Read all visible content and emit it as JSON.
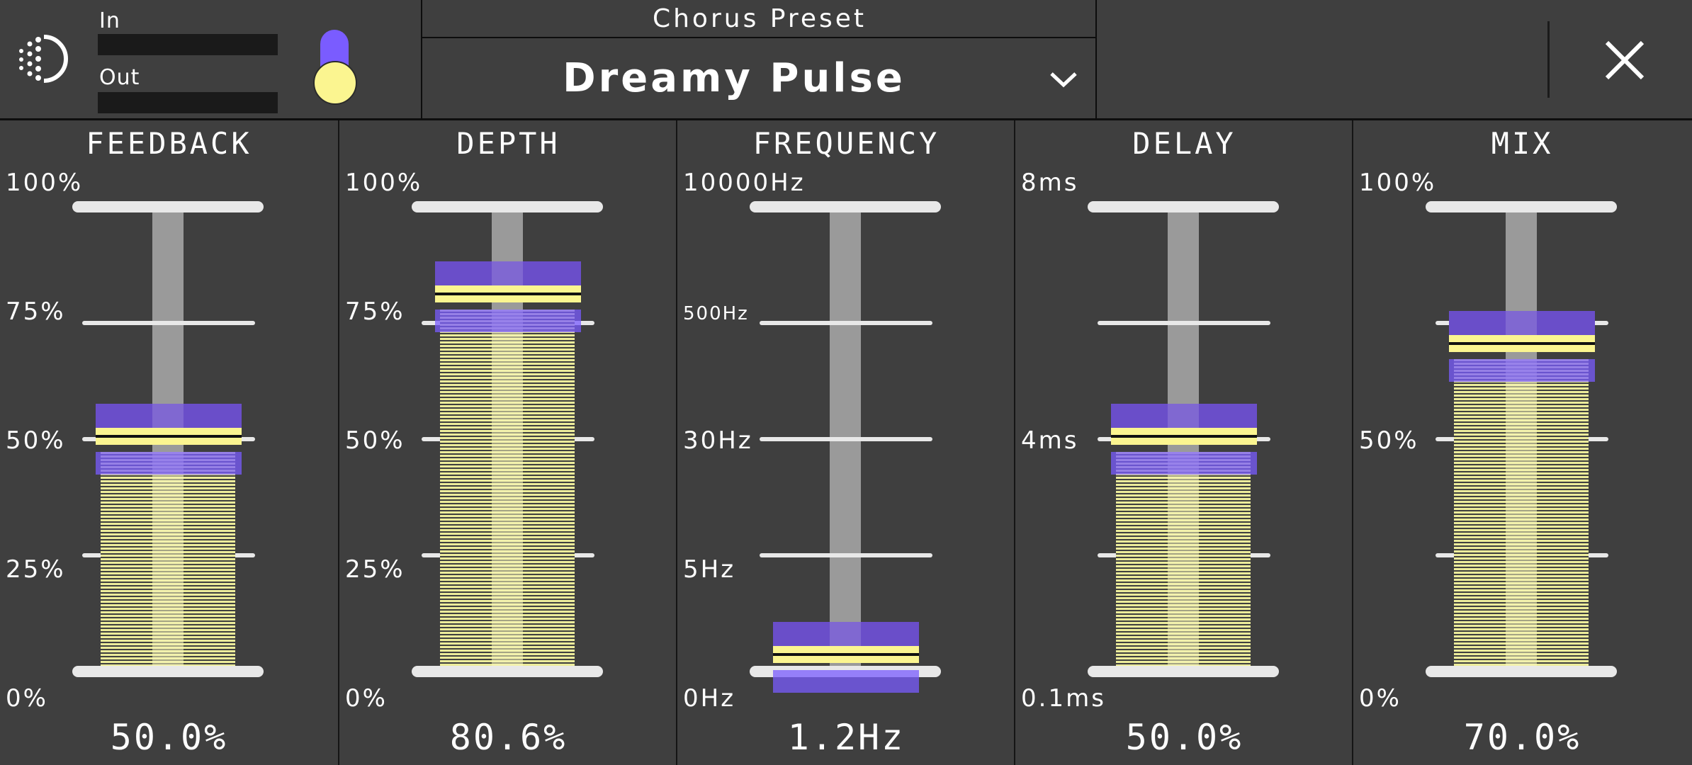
{
  "header": {
    "meters": {
      "in_label": "In",
      "out_label": "Out"
    },
    "preset": {
      "label": "Chorus Preset",
      "name": "Dreamy Pulse"
    },
    "icons": {
      "logo": "plugin-logo-icon",
      "dropdown": "chevron-down-icon",
      "close": "close-icon"
    },
    "toggle": {
      "state": "on"
    }
  },
  "colors": {
    "background": "#3f3f3f",
    "accent_purple": "#7a5cff",
    "accent_yellow": "#fbf590",
    "rail": "#e8e8e8",
    "track": "#9a9a9a"
  },
  "faders": [
    {
      "id": "feedback",
      "title": "FEEDBACK",
      "value": "50.0%",
      "level": 0.5,
      "ticks": [
        "100%",
        "75%",
        "50%",
        "25%",
        "0%"
      ]
    },
    {
      "id": "depth",
      "title": "DEPTH",
      "value": "80.6%",
      "level": 0.806,
      "ticks": [
        "100%",
        "75%",
        "50%",
        "25%",
        "0%"
      ]
    },
    {
      "id": "frequency",
      "title": "FREQUENCY",
      "value": "1.2Hz",
      "level": 0.03,
      "ticks": [
        "10000Hz",
        "500Hz",
        "30Hz",
        "5Hz",
        "0Hz"
      ]
    },
    {
      "id": "delay",
      "title": "DELAY",
      "value": "50.0%",
      "level": 0.5,
      "ticks": [
        "8ms",
        "",
        "4ms",
        "",
        "0.1ms"
      ]
    },
    {
      "id": "mix",
      "title": "MIX",
      "value": "70.0%",
      "level": 0.7,
      "ticks": [
        "100%",
        "",
        "50%",
        "",
        "0%"
      ]
    }
  ]
}
